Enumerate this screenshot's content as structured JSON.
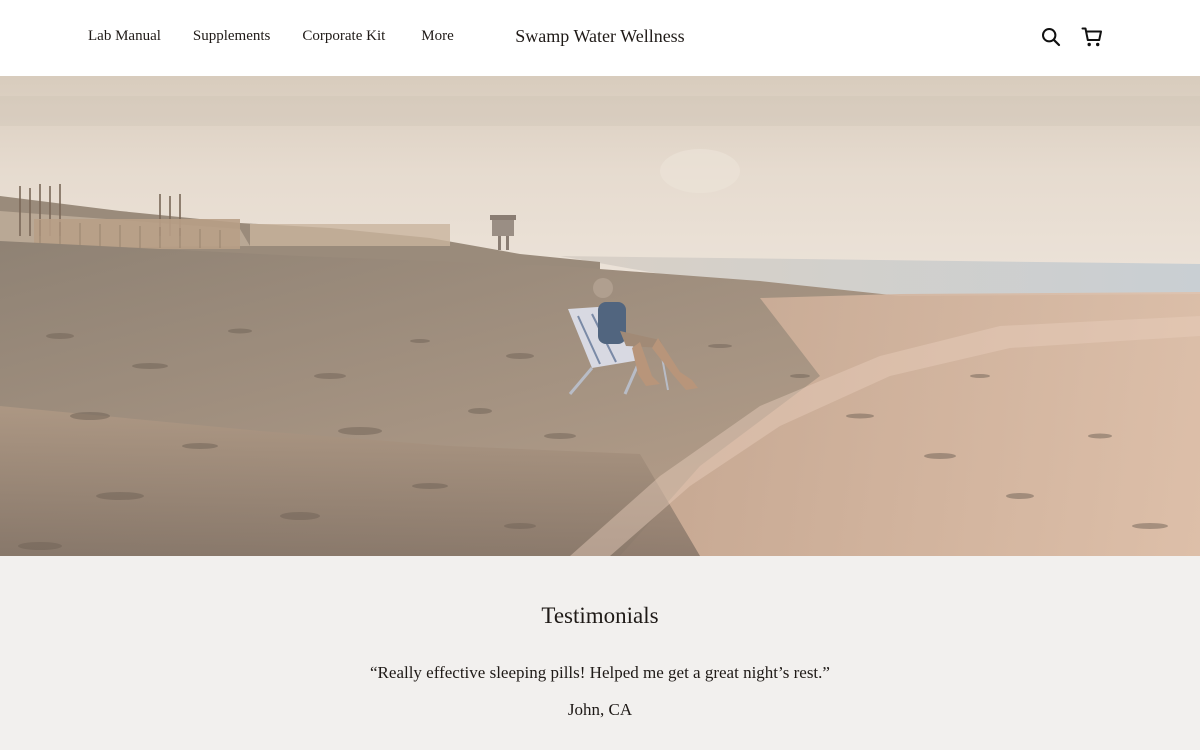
{
  "header": {
    "nav": [
      {
        "label": "Lab Manual"
      },
      {
        "label": "Supplements"
      },
      {
        "label": "Corporate Kit"
      },
      {
        "label": "More"
      }
    ],
    "brand": "Swamp Water Wellness",
    "icons": [
      "search-icon",
      "cart-icon"
    ]
  },
  "hero": {
    "image": "beach-scene-person-in-chair"
  },
  "testimonials": {
    "title": "Testimonials",
    "quote": "“Really effective sleeping pills! Helped me get a great night’s rest.”",
    "author": "John, CA"
  }
}
